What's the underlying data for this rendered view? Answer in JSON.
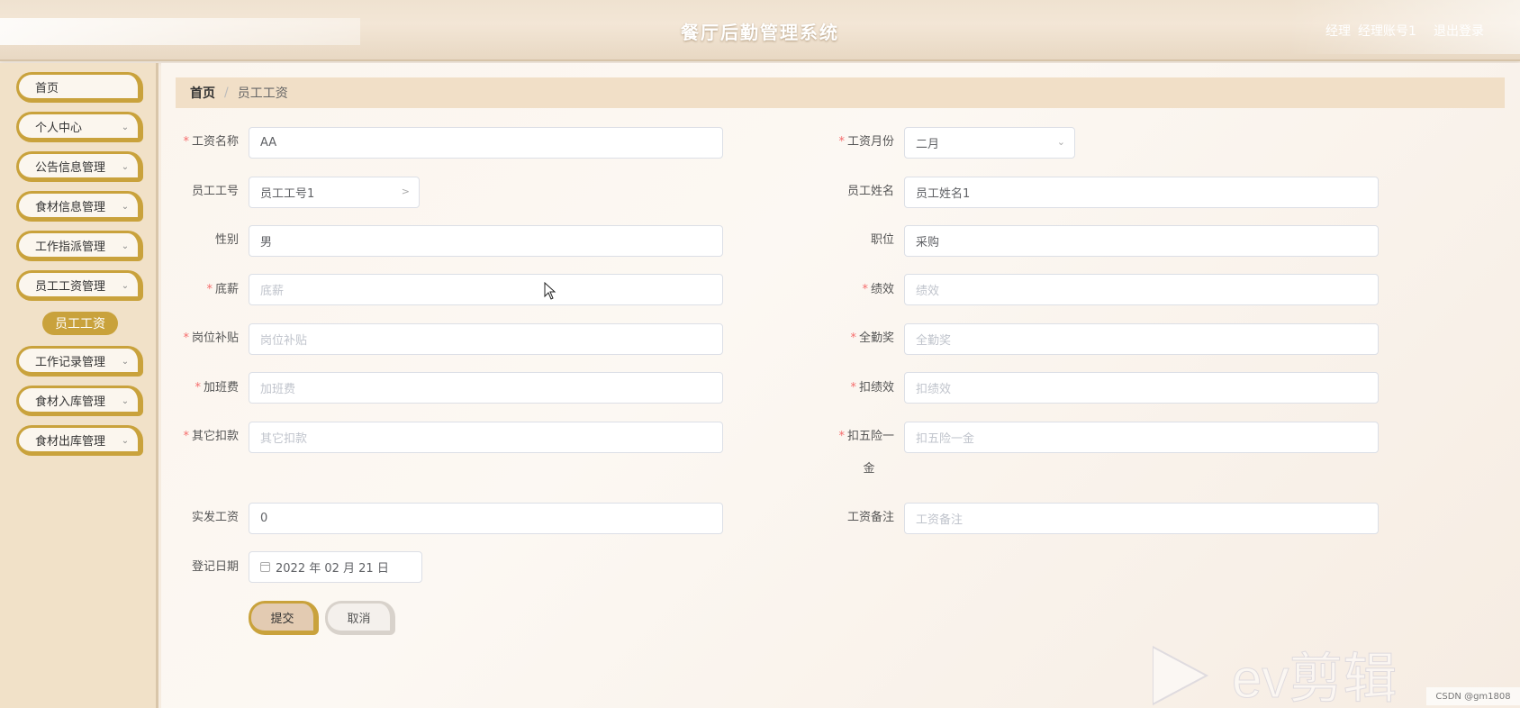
{
  "header": {
    "title": "餐厅后勤管理系统",
    "role": "经理",
    "user": "经理账号1",
    "logout": "退出登录"
  },
  "sidebar": {
    "items": [
      {
        "label": "首页"
      },
      {
        "label": "个人中心"
      },
      {
        "label": "公告信息管理"
      },
      {
        "label": "食材信息管理"
      },
      {
        "label": "工作指派管理"
      },
      {
        "label": "员工工资管理"
      },
      {
        "label": "工作记录管理"
      },
      {
        "label": "食材入库管理"
      },
      {
        "label": "食材出库管理"
      }
    ],
    "submenu_active": "员工工资"
  },
  "breadcrumb": {
    "home": "首页",
    "separator": "/",
    "current": "员工工资"
  },
  "form": {
    "salary_name": {
      "label": "工资名称",
      "value": "AA",
      "required": true
    },
    "salary_month": {
      "label": "工资月份",
      "value": "二月",
      "required": true
    },
    "employee_id": {
      "label": "员工工号",
      "value": "员工工号1"
    },
    "employee_name": {
      "label": "员工姓名",
      "value": "员工姓名1"
    },
    "gender": {
      "label": "性别",
      "value": "男"
    },
    "position": {
      "label": "职位",
      "value": "采购"
    },
    "base_salary": {
      "label": "底薪",
      "placeholder": "底薪",
      "required": true
    },
    "performance": {
      "label": "绩效",
      "placeholder": "绩效",
      "required": true
    },
    "post_allowance": {
      "label": "岗位补贴",
      "placeholder": "岗位补贴",
      "required": true
    },
    "attendance_bonus": {
      "label": "全勤奖",
      "placeholder": "全勤奖",
      "required": true
    },
    "overtime_pay": {
      "label": "加班费",
      "placeholder": "加班费",
      "required": true
    },
    "perf_deduction": {
      "label": "扣绩效",
      "placeholder": "扣绩效",
      "required": true
    },
    "other_deduction": {
      "label": "其它扣款",
      "placeholder": "其它扣款",
      "required": true
    },
    "insurance_deduction": {
      "label_line1": "扣五险一",
      "label_line2": "金",
      "placeholder": "扣五险一金",
      "required": true
    },
    "actual_salary": {
      "label": "实发工资",
      "value": "0"
    },
    "salary_remark": {
      "label": "工资备注",
      "placeholder": "工资备注"
    },
    "register_date": {
      "label": "登记日期",
      "value": "2022 年 02 月 21 日"
    },
    "required_mark": "*"
  },
  "buttons": {
    "submit": "提交",
    "cancel": "取消"
  },
  "watermark": {
    "ev_text": "ev剪辑",
    "csdn": "CSDN @gm1808"
  },
  "colors": {
    "accent": "#c9a23c",
    "sidebar_bg": "#f1e1c8",
    "required": "#f56c6c"
  }
}
